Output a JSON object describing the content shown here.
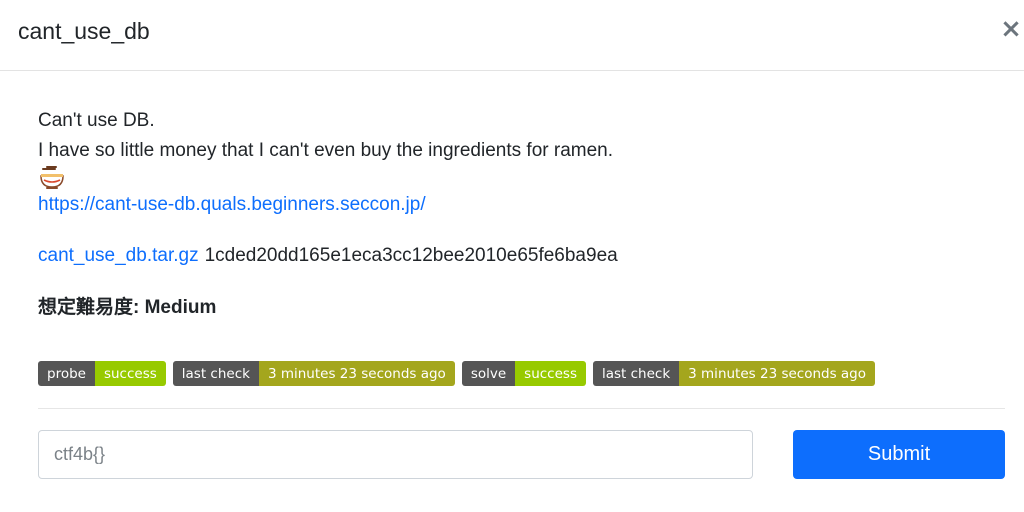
{
  "modal": {
    "title": "cant_use_db",
    "close_label": "×"
  },
  "description": {
    "line1": "Can't use DB.",
    "line2": "I have so little money that I can't even buy the ingredients for ramen.",
    "emoji": "ramen-bowl",
    "url": "https://cant-use-db.quals.beginners.seccon.jp/"
  },
  "attachment": {
    "filename": "cant_use_db.tar.gz",
    "hash": "1cded20dd165e1eca3cc12bee2010e65fe6ba9ea"
  },
  "difficulty": "想定難易度: Medium",
  "badges": [
    {
      "label": "probe",
      "value": "success",
      "color": "#97ca00"
    },
    {
      "label": "last check",
      "value": "3 minutes 23 seconds ago",
      "color": "#a4a61d"
    },
    {
      "label": "solve",
      "value": "success",
      "color": "#97ca00"
    },
    {
      "label": "last check",
      "value": "3 minutes 23 seconds ago",
      "color": "#a4a61d"
    }
  ],
  "form": {
    "placeholder": "ctf4b{}",
    "submit_label": "Submit"
  },
  "colors": {
    "link": "#0d6efd",
    "button": "#0d6efd",
    "badge_label": "#555555"
  }
}
